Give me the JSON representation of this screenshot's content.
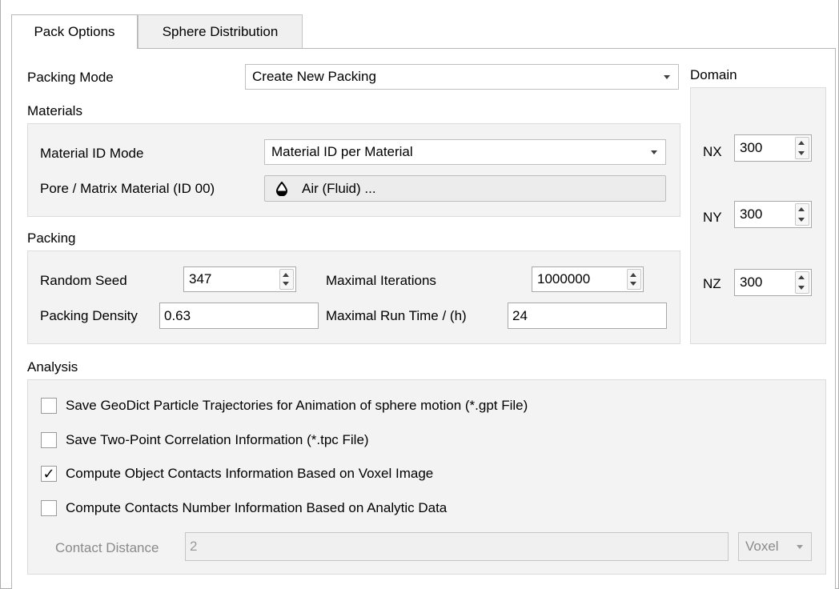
{
  "tabs": [
    {
      "label": "Pack Options",
      "active": true
    },
    {
      "label": "Sphere Distribution",
      "active": false
    }
  ],
  "packing_mode": {
    "label": "Packing Mode",
    "value": "Create New Packing"
  },
  "materials": {
    "title": "Materials",
    "material_id_mode": {
      "label": "Material ID Mode",
      "value": "Material ID per Material"
    },
    "pore_matrix": {
      "label": "Pore / Matrix Material (ID 00)",
      "value": "Air (Fluid) ...",
      "icon": "droplet-icon"
    }
  },
  "packing": {
    "title": "Packing",
    "random_seed": {
      "label": "Random Seed",
      "value": "347"
    },
    "maximal_iterations": {
      "label": "Maximal Iterations",
      "value": "1000000"
    },
    "packing_density": {
      "label": "Packing Density",
      "value": "0.63"
    },
    "maximal_run_time": {
      "label": "Maximal Run Time / (h)",
      "value": "24"
    }
  },
  "domain": {
    "title": "Domain",
    "nx": {
      "label": "NX",
      "value": "300"
    },
    "ny": {
      "label": "NY",
      "value": "300"
    },
    "nz": {
      "label": "NZ",
      "value": "300"
    }
  },
  "analysis": {
    "title": "Analysis",
    "options": [
      {
        "label": "Save GeoDict Particle Trajectories for Animation of sphere motion (*.gpt File)",
        "checked": false
      },
      {
        "label": "Save Two-Point Correlation Information (*.tpc File)",
        "checked": false
      },
      {
        "label": "Compute Object Contacts Information Based on Voxel Image",
        "checked": true
      },
      {
        "label": "Compute Contacts Number Information Based on Analytic Data",
        "checked": false
      }
    ],
    "contact_distance": {
      "label": "Contact Distance",
      "value": "2",
      "unit": "Voxel"
    }
  },
  "glyphs": {
    "check": "✓"
  }
}
